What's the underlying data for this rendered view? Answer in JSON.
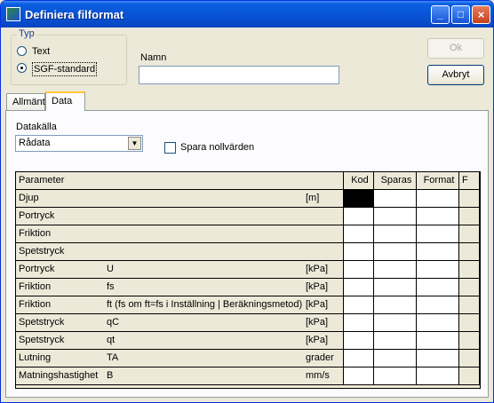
{
  "window": {
    "title": "Definiera filformat"
  },
  "typ_group": {
    "legend": "Typ",
    "options": [
      {
        "label": "Text",
        "selected": false
      },
      {
        "label": "SGF-standard",
        "selected": true
      }
    ]
  },
  "namn": {
    "label": "Namn",
    "value": ""
  },
  "buttons": {
    "ok": "Ok",
    "cancel": "Avbryt"
  },
  "tabs": [
    {
      "label": "Allmänt",
      "active": false
    },
    {
      "label": "Data",
      "active": true
    }
  ],
  "datakalla": {
    "label": "Datakälla",
    "selected": "Rådata"
  },
  "spara_nollvarden": {
    "label": "Spara nollvärden",
    "checked": false
  },
  "grid": {
    "columns": [
      "Parameter",
      "Kod",
      "Sparas",
      "Format",
      "F"
    ],
    "rows": [
      {
        "name": "Djup",
        "code": "",
        "unit": "[m]"
      },
      {
        "name": "Portryck",
        "code": "",
        "unit": ""
      },
      {
        "name": "Friktion",
        "code": "",
        "unit": ""
      },
      {
        "name": "Spetstryck",
        "code": "",
        "unit": ""
      },
      {
        "name": "Portryck",
        "code": "U",
        "unit": "[kPa]"
      },
      {
        "name": "Friktion",
        "code": "fs",
        "unit": "[kPa]"
      },
      {
        "name": "Friktion",
        "code": "ft (fs om ft=fs i Inställning | Beräkningsmetod)",
        "unit": "[kPa]"
      },
      {
        "name": "Spetstryck",
        "code": "qC",
        "unit": "[kPa]"
      },
      {
        "name": "Spetstryck",
        "code": "qt",
        "unit": "[kPa]"
      },
      {
        "name": "Lutning",
        "code": "TA",
        "unit": "grader"
      },
      {
        "name": "Matningshastighet",
        "code": "B",
        "unit": "mm/s"
      }
    ]
  },
  "colors": {
    "titlebar": "#0852d4",
    "window_bg": "#ece9d8",
    "selected_cell": "#000000"
  }
}
